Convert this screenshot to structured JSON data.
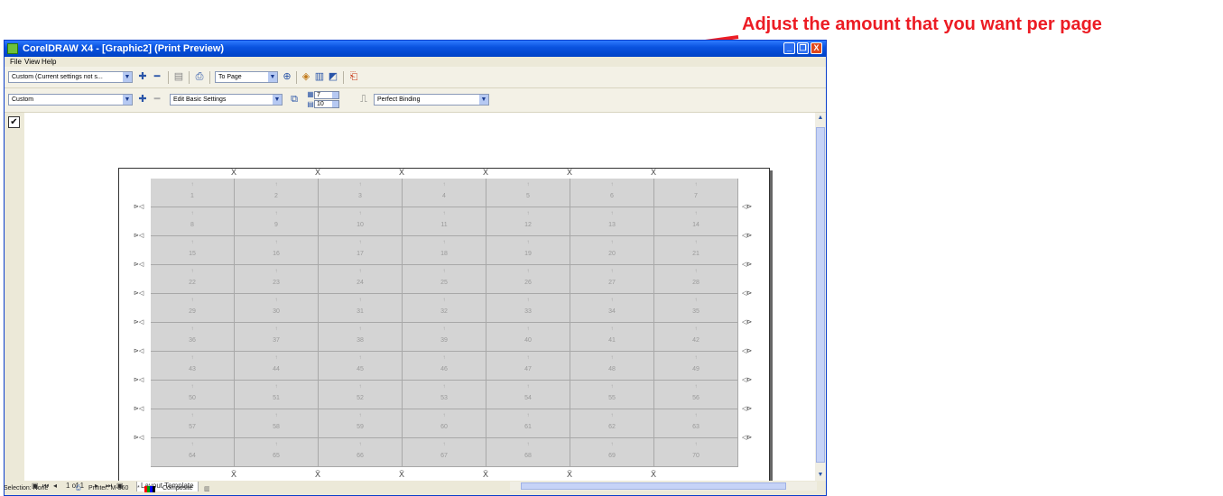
{
  "annotation": {
    "text": "Adjust the amount that you want per page",
    "color": "#ec1c24"
  },
  "window": {
    "title": "CorelDRAW X4 - [Graphic2] (Print Preview)",
    "buttons": {
      "minimize": "_",
      "restore": "❐",
      "close": "X"
    }
  },
  "menu": [
    "File",
    "View",
    "Help"
  ],
  "toolbar1": {
    "preset_combo": "Custom (Current settings not s...",
    "zoom_combo": "To Page"
  },
  "toolbar2": {
    "layout_combo": "Custom",
    "settings_combo": "Edit Basic Settings",
    "columns_value": "7",
    "rows_value": "10",
    "binding_combo": "Perfect Binding"
  },
  "sheet": {
    "columns": 7,
    "rows": 10,
    "cell_numbers": [
      "1",
      "2",
      "3",
      "4",
      "5",
      "6",
      "7",
      "8",
      "9",
      "10",
      "11",
      "12",
      "13",
      "14",
      "15",
      "16",
      "17",
      "18",
      "19",
      "20",
      "21",
      "22",
      "23",
      "24",
      "25",
      "26",
      "27",
      "28",
      "29",
      "30",
      "31",
      "32",
      "33",
      "34",
      "35",
      "36",
      "37",
      "38",
      "39",
      "40",
      "41",
      "42",
      "43",
      "44",
      "45",
      "46",
      "47",
      "48",
      "49",
      "50",
      "51",
      "52",
      "53",
      "54",
      "55",
      "56",
      "57",
      "58",
      "59",
      "60",
      "61",
      "62",
      "63",
      "64",
      "65",
      "66",
      "67",
      "68",
      "69",
      "70"
    ]
  },
  "pagebar": {
    "page_indicator": "1 of 1",
    "tab": "Layout Template"
  },
  "status": {
    "selection": "Selection: None",
    "printer": "Printer: M-360",
    "mode": "Composite"
  }
}
